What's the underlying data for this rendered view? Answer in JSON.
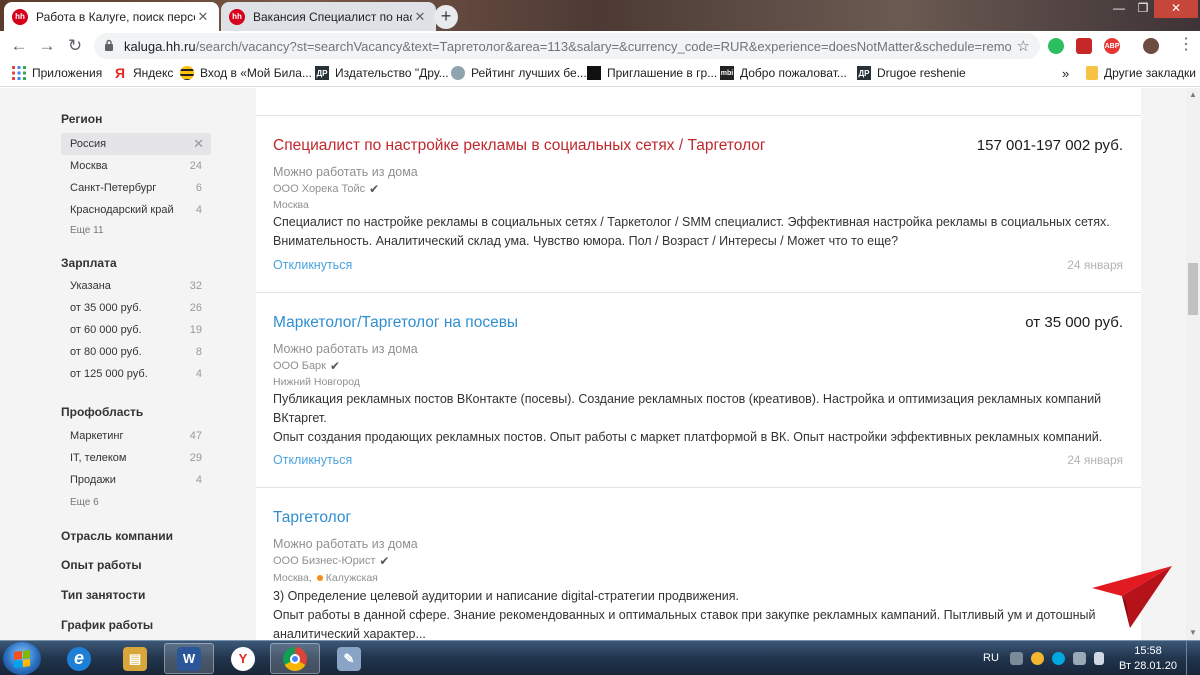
{
  "browser": {
    "tabs": [
      {
        "title": "Работа в Калуге, поиск персона",
        "favicon": "hh",
        "active": true,
        "close": "✕"
      },
      {
        "title": "Вакансия Специалист по настро",
        "favicon": "hh",
        "active": false,
        "close": "✕"
      }
    ],
    "new_tab": "+",
    "window_controls": {
      "minimize": "—",
      "maximize": "❐",
      "close": "✕"
    }
  },
  "toolbar": {
    "back": "←",
    "forward": "→",
    "reload": "↻",
    "url_host": "kaluga.hh.ru",
    "url_path": "/search/vacancy?st=searchVacancy&text=Таргетолог&area=113&salary=&currency_code=RUR&experience=doesNotMatter&schedule=remote&o...",
    "extensions": [
      "evernote-icon",
      "cutter-icon",
      "adblock-icon",
      "profile-avatar"
    ],
    "adblock_label": "ABP",
    "menu": "⋮"
  },
  "bookmarks": {
    "items": [
      {
        "label": "Приложения",
        "icon": "apps-grid-icon"
      },
      {
        "label": "Яндекс",
        "icon": "yandex-icon"
      },
      {
        "label": "Вход в «Мой Била...",
        "icon": "beeline-icon"
      },
      {
        "label": "Издательство \"Дру...",
        "icon": "drugoe-icon"
      },
      {
        "label": "Рейтинг лучших бе...",
        "icon": "rating-icon"
      },
      {
        "label": "Приглашение в гр...",
        "icon": "invite-icon"
      },
      {
        "label": "Добро пожаловат...",
        "icon": "mbi-icon"
      },
      {
        "label": "Drugoe reshenie",
        "icon": "drugoe-icon"
      }
    ],
    "more": "»",
    "other": "Другие закладки"
  },
  "sidebar": {
    "groups": [
      {
        "title": "Регион",
        "items": [
          {
            "label": "Россия",
            "count": "",
            "selected": true
          },
          {
            "label": "Москва",
            "count": "24"
          },
          {
            "label": "Санкт-Петербург",
            "count": "6"
          },
          {
            "label": "Краснодарский край",
            "count": "4"
          }
        ],
        "more": "Еще 11"
      },
      {
        "title": "Зарплата",
        "items": [
          {
            "label": "Указана",
            "count": "32"
          },
          {
            "label": "от 35 000 руб.",
            "count": "26"
          },
          {
            "label": "от 60 000 руб.",
            "count": "19"
          },
          {
            "label": "от 80 000 руб.",
            "count": "8"
          },
          {
            "label": "от 125 000 руб.",
            "count": "4"
          }
        ]
      },
      {
        "title": "Профобласть",
        "items": [
          {
            "label": "Маркетинг",
            "count": "47"
          },
          {
            "label": "IT, телеком",
            "count": "29"
          },
          {
            "label": "Продажи",
            "count": "4"
          }
        ],
        "more": "Еще 6"
      }
    ],
    "collapsed": [
      "Отрасль компании",
      "Опыт работы",
      "Тип занятости",
      "График работы"
    ],
    "remove_glyph": "✕"
  },
  "vacancies": [
    {
      "title": "Специалист по настройке рекламы в социальных сетях / Таргетолог",
      "visited": true,
      "salary": "157 001-197 002 руб.",
      "remote": "Можно работать из дома",
      "company": "ООО Хорека Тойс",
      "city": "Москва",
      "metro": "",
      "desc": [
        "Специалист по настройке рекламы в социальных сетях / Таркетолог / SMM специалист. Эффективная настройка рекламы в социальных сетях.",
        "Внимательность. Аналитический склад ума. Чувство юмора. Пол / Возраст / Интересы / Может что то еще?"
      ],
      "apply": "Откликнуться",
      "date": "24 января"
    },
    {
      "title": "Маркетолог/Таргетолог на посевы",
      "visited": false,
      "salary": "от 35 000 руб.",
      "remote": "Можно работать из дома",
      "company": "ООО Барк",
      "city": "Нижний Новгород",
      "metro": "",
      "desc": [
        "Публикация рекламных постов ВКонтакте (посевы). Создание рекламных постов (креативов). Настройка и оптимизация рекламных компаний",
        "ВКтаргет.",
        "Опыт создания продающих рекламных постов. Опыт работы с маркет платформой в ВК. Опыт настройки эффективных рекламных компаний."
      ],
      "apply": "Откликнуться",
      "date": "24 января"
    },
    {
      "title": "Таргетолог",
      "visited": false,
      "salary": "",
      "remote": "Можно работать из дома",
      "company": "ООО Бизнес-Юрист",
      "city": "Москва,",
      "metro": "Калужская",
      "desc": [
        "3) Определение целевой аудитории и написание digital-стратегии продвижения.",
        "Опыт работы в данной сфере. Знание рекомендованных и оптимальных ставок при закупке рекламных кампаний. Пытливый ум и дотошный",
        "аналитический характер..."
      ],
      "apply": "",
      "date": ""
    }
  ],
  "check_glyph": "✔",
  "taskbar": {
    "apps": [
      {
        "name": "ie",
        "glyph": "e",
        "color": "#1d7fd6"
      },
      {
        "name": "explorer",
        "glyph": "▤",
        "color": "#d8a63b"
      },
      {
        "name": "word",
        "glyph": "W",
        "color": "#2b579a"
      },
      {
        "name": "yandex",
        "glyph": "Y",
        "color": "#e52620"
      },
      {
        "name": "chrome",
        "glyph": "◉",
        "color": "#3f9a48"
      },
      {
        "name": "paint",
        "glyph": "✎",
        "color": "#8aa4c8"
      }
    ],
    "lang": "RU",
    "time": "15:58",
    "date": "Вт 28.01.20"
  },
  "colors": {
    "hh_red": "#d6001c",
    "link_blue": "#2f8ed1",
    "visited_red": "#c1272d",
    "promo_red": "#e21b23"
  }
}
